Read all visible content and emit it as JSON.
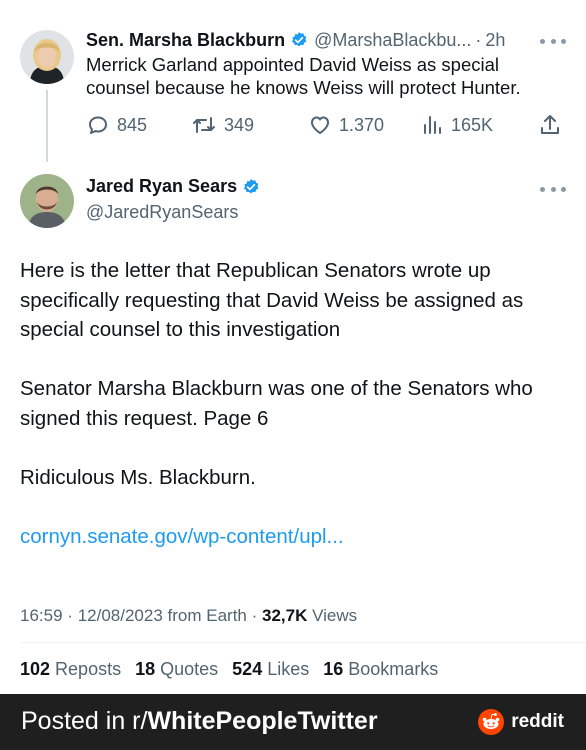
{
  "parent_tweet": {
    "name": "Sen. Marsha Blackburn",
    "handle": "@MarshaBlackbu...",
    "dot": "·",
    "time": "2h",
    "text": "Merrick Garland appointed David Weiss as special counsel because he knows Weiss will protect Hunter.",
    "replies": "845",
    "reposts": "349",
    "likes": "1.370",
    "views": "165K"
  },
  "main_tweet": {
    "name": "Jared Ryan Sears",
    "handle": "@JaredRyanSears",
    "paragraphs": [
      "Here is the letter that Republican Senators wrote up specifically requesting that David Weiss be assigned as special counsel to this investigation",
      "Senator Marsha Blackburn was one of the Senators who signed this request. Page 6",
      "Ridiculous Ms. Blackburn."
    ],
    "link": "cornyn.senate.gov/wp-content/upl...",
    "meta": {
      "time": "16:59",
      "dot": "·",
      "date": "12/08/2023",
      "source": "from Earth",
      "views_count": "32,7K",
      "views_label": "Views"
    },
    "stats": {
      "reposts_count": "102",
      "reposts_label": "Reposts",
      "quotes_count": "18",
      "quotes_label": "Quotes",
      "likes_count": "524",
      "likes_label": "Likes",
      "bookmarks_count": "16",
      "bookmarks_label": "Bookmarks"
    }
  },
  "footer": {
    "posted_prefix": "Posted in r/",
    "subreddit": "WhitePeopleTwitter",
    "brand": "reddit"
  },
  "colors": {
    "verified": "#1d9bf0",
    "link": "#1d9bf0",
    "muted": "#536471",
    "footer_bg": "#1f1f1f",
    "reddit_orange": "#ff4500"
  },
  "icons": [
    "verified-badge-icon",
    "more-icon",
    "reply-icon",
    "repost-icon",
    "like-icon",
    "views-icon",
    "share-icon",
    "reddit-logo-icon"
  ]
}
